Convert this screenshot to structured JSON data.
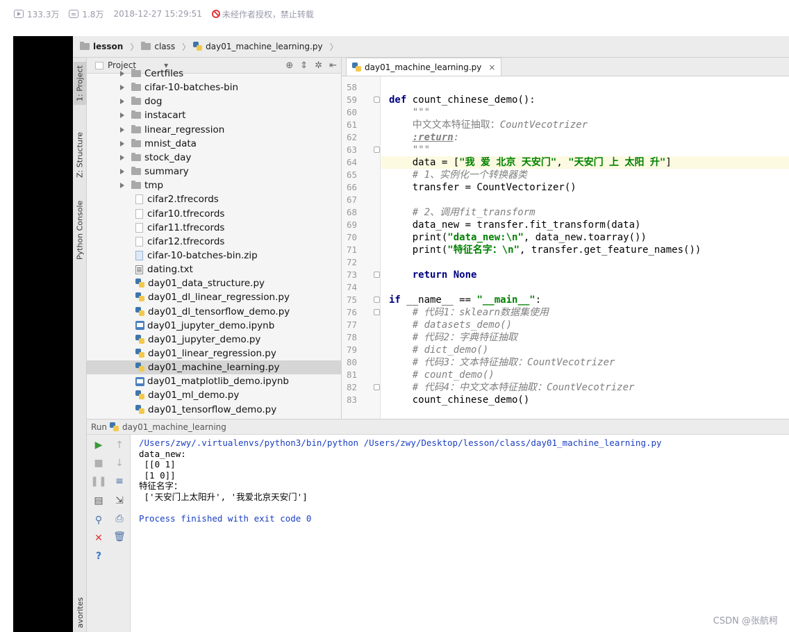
{
  "meta": {
    "views": "133.3万",
    "comments": "1.8万",
    "datetime": "2018-12-27 15:29:51",
    "copyright": "未经作者授权，禁止转载"
  },
  "navbar": {
    "crumbs": [
      "lesson",
      "class",
      "day01_machine_learning.py"
    ]
  },
  "toolstrip": {
    "project_tab": "1: Project",
    "structure_tab": "Z: Structure",
    "console_tab": "Python Console",
    "favorites_tab": "avorites"
  },
  "project": {
    "title": "Project",
    "items": [
      {
        "label": "Certfiles",
        "kind": "folder"
      },
      {
        "label": "cifar-10-batches-bin",
        "kind": "folder"
      },
      {
        "label": "dog",
        "kind": "folder"
      },
      {
        "label": "instacart",
        "kind": "folder"
      },
      {
        "label": "linear_regression",
        "kind": "folder"
      },
      {
        "label": "mnist_data",
        "kind": "folder"
      },
      {
        "label": "stock_day",
        "kind": "folder"
      },
      {
        "label": "summary",
        "kind": "folder"
      },
      {
        "label": "tmp",
        "kind": "folder"
      },
      {
        "label": "cifar2.tfrecords",
        "kind": "file"
      },
      {
        "label": "cifar10.tfrecords",
        "kind": "file"
      },
      {
        "label": "cifar11.tfrecords",
        "kind": "file"
      },
      {
        "label": "cifar12.tfrecords",
        "kind": "file"
      },
      {
        "label": "cifar-10-batches-bin.zip",
        "kind": "zip"
      },
      {
        "label": "dating.txt",
        "kind": "txt"
      },
      {
        "label": "day01_data_structure.py",
        "kind": "py"
      },
      {
        "label": "day01_dl_linear_regression.py",
        "kind": "py"
      },
      {
        "label": "day01_dl_tensorflow_demo.py",
        "kind": "py"
      },
      {
        "label": "day01_jupyter_demo.ipynb",
        "kind": "nb"
      },
      {
        "label": "day01_jupyter_demo.py",
        "kind": "py"
      },
      {
        "label": "day01_linear_regression.py",
        "kind": "py"
      },
      {
        "label": "day01_machine_learning.py",
        "kind": "py",
        "selected": true
      },
      {
        "label": "day01_matplotlib_demo.ipynb",
        "kind": "nb"
      },
      {
        "label": "day01_ml_demo.py",
        "kind": "py"
      },
      {
        "label": "day01_tensorflow_demo.py",
        "kind": "py"
      }
    ]
  },
  "editor": {
    "tab_label": "day01_machine_learning.py",
    "lines": [
      {
        "n": "58",
        "html": ""
      },
      {
        "n": "59",
        "html": "<span class='kw'>def</span> count_chinese_demo():",
        "fold": true
      },
      {
        "n": "60",
        "html": "    <span class='doc'>\"\"\"</span>"
      },
      {
        "n": "61",
        "html": "    <span class='doc'>中文文本特征抽取：</span><span class='docitalic'>CountVecotrizer</span>"
      },
      {
        "n": "62",
        "html": "    <span class='docitalic' style='font-weight:bold;text-decoration:underline'>:return</span><span class='docitalic'>:</span>"
      },
      {
        "n": "63",
        "html": "    <span class='doc'>\"\"\"</span>",
        "fold": true
      },
      {
        "n": "64",
        "html": "    data = [<span class='str'>\"我 爱 北京 天安门\"</span>, <span class='str'>\"天安门 上 太阳 升\"</span>]",
        "hl": true
      },
      {
        "n": "65",
        "html": "    <span class='cm'># 1、实例化一个转换器类</span>"
      },
      {
        "n": "66",
        "html": "    transfer = CountVectorizer()"
      },
      {
        "n": "67",
        "html": ""
      },
      {
        "n": "68",
        "html": "    <span class='cm'># 2、调用fit_transform</span>"
      },
      {
        "n": "69",
        "html": "    data_new = transfer.fit_transform(data)"
      },
      {
        "n": "70",
        "html": "    print(<span class='str'>\"data_new:\\n\"</span>, data_new.toarray())"
      },
      {
        "n": "71",
        "html": "    print(<span class='str'>\"特征名字：\\n\"</span>, transfer.get_feature_names())"
      },
      {
        "n": "72",
        "html": ""
      },
      {
        "n": "73",
        "html": "    <span class='kw'>return None</span>",
        "fold": true
      },
      {
        "n": "74",
        "html": ""
      },
      {
        "n": "75",
        "html": "<span class='kw'>if</span> __name__ == <span class='str'>\"__main__\"</span>:",
        "fold": true
      },
      {
        "n": "76",
        "html": "    <span class='cm'># 代码1：sklearn数据集使用</span>",
        "fold": true
      },
      {
        "n": "77",
        "html": "    <span class='cm'># datasets_demo()</span>"
      },
      {
        "n": "78",
        "html": "    <span class='cm'># 代码2：字典特征抽取</span>"
      },
      {
        "n": "79",
        "html": "    <span class='cm'># dict_demo()</span>"
      },
      {
        "n": "80",
        "html": "    <span class='cm'># 代码3：文本特征抽取：CountVecotrizer</span>"
      },
      {
        "n": "81",
        "html": "    <span class='cm'># count_demo()</span>"
      },
      {
        "n": "82",
        "html": "    <span class='cm'># 代码4：中文文本特征抽取：CountVecotrizer</span>",
        "fold": true
      },
      {
        "n": "83",
        "html": "    count_chinese_demo()"
      }
    ]
  },
  "run": {
    "title": "Run",
    "config": "day01_machine_learning",
    "output": [
      {
        "text": "/Users/zwy/.virtualenvs/python3/bin/python /Users/zwy/Desktop/lesson/class/day01_machine_learning.py",
        "blue": true
      },
      {
        "text": "data_new:"
      },
      {
        "text": " [[0 1]"
      },
      {
        "text": " [1 0]]"
      },
      {
        "text": "特征名字："
      },
      {
        "text": " ['天安门上太阳升', '我爱北京天安门']"
      },
      {
        "text": ""
      },
      {
        "text": "Process finished with exit code 0",
        "blue": true
      }
    ]
  },
  "watermark": "CSDN @张航柯"
}
